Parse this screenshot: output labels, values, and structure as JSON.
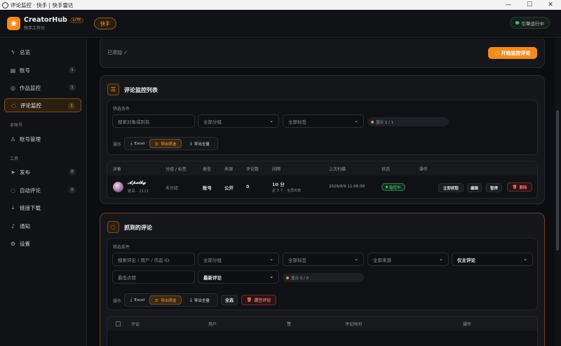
{
  "window": {
    "title": "评论监控 · 快手 | 快手雷达",
    "minimize": "—",
    "maximize": "☐",
    "close": "✕"
  },
  "header": {
    "brand": "CreatorHub",
    "badge": "LITE",
    "subtitle": "快手工作台",
    "platform": "快手",
    "engine_status": "引擎运行中"
  },
  "sidebar": {
    "items": [
      {
        "label": "总览",
        "icon": "ϟ",
        "count": ""
      },
      {
        "label": "账号",
        "icon": "▤",
        "count": "1"
      },
      {
        "label": "作品监控",
        "icon": "◎",
        "count": "1"
      },
      {
        "label": "评论监控",
        "icon": "◌",
        "count": "1"
      },
      {
        "label": "账号管理",
        "icon": "♙",
        "count": ""
      },
      {
        "label": "发布",
        "icon": "➤",
        "count": "0"
      },
      {
        "label": "自动评论",
        "icon": "◌",
        "count": "0"
      },
      {
        "label": "链接下载",
        "icon": "⤓",
        "count": ""
      },
      {
        "label": "通知",
        "icon": "♪",
        "count": ""
      },
      {
        "label": "设置",
        "icon": "⚙",
        "count": ""
      }
    ],
    "section_account": "本账号",
    "section_tools": "工具"
  },
  "top_card": {
    "added_text": "已添加 ✓",
    "start_button": "开始监控评论",
    "start_icon": "◌"
  },
  "monitor_list": {
    "title": "评论监控列表",
    "title_icon": "☰",
    "filter_label": "筛选条件",
    "search_placeholder": "搜索对象或别名",
    "group_select": "全部分组",
    "tag_select": "全部标签",
    "count": "显示 1 / 1",
    "ops_label": "操作",
    "excel": "Excel",
    "export_filtered": "导出筛选",
    "export_all": "导出全量",
    "columns": [
      "对象",
      "分组 / 标签",
      "类型",
      "来源",
      "评论数",
      "间隔",
      "上次扫描",
      "状态",
      "操作"
    ],
    "row": {
      "name": "𝓐𝓹𝓪𝓽𝓱𝔂",
      "alias": "别名 · 1111",
      "group": "未分组",
      "type": "账号",
      "source": "公开",
      "comments": "0",
      "interval": "10 分",
      "interval_sub": "近 3 个 · 全局天数",
      "last_scan": "2026/8/9 11:06:58",
      "status": "监控中",
      "btn_fetch": "立即抓取",
      "btn_edit": "编辑",
      "btn_pause": "暂停",
      "btn_delete": "删除"
    }
  },
  "captured": {
    "title": "抓到的评论",
    "title_icon": "◌",
    "filter_label": "筛选条件",
    "search_placeholder": "搜索评论 / 用户 / 作品 ID",
    "group_select": "全部分组",
    "tag_select": "全部标签",
    "source_select": "全部来源",
    "owner_select": "仅主评论",
    "likes_placeholder": "最低点赞",
    "sort_select": "最新评论",
    "count": "显示 0 / 0",
    "ops_label": "操作",
    "excel": "Excel",
    "export_filtered": "导出筛选",
    "export_all": "导出全量",
    "select_all": "全选",
    "clear": "清空评论",
    "columns": [
      "评论",
      "用户",
      "赞",
      "评论时间",
      "操作"
    ]
  }
}
